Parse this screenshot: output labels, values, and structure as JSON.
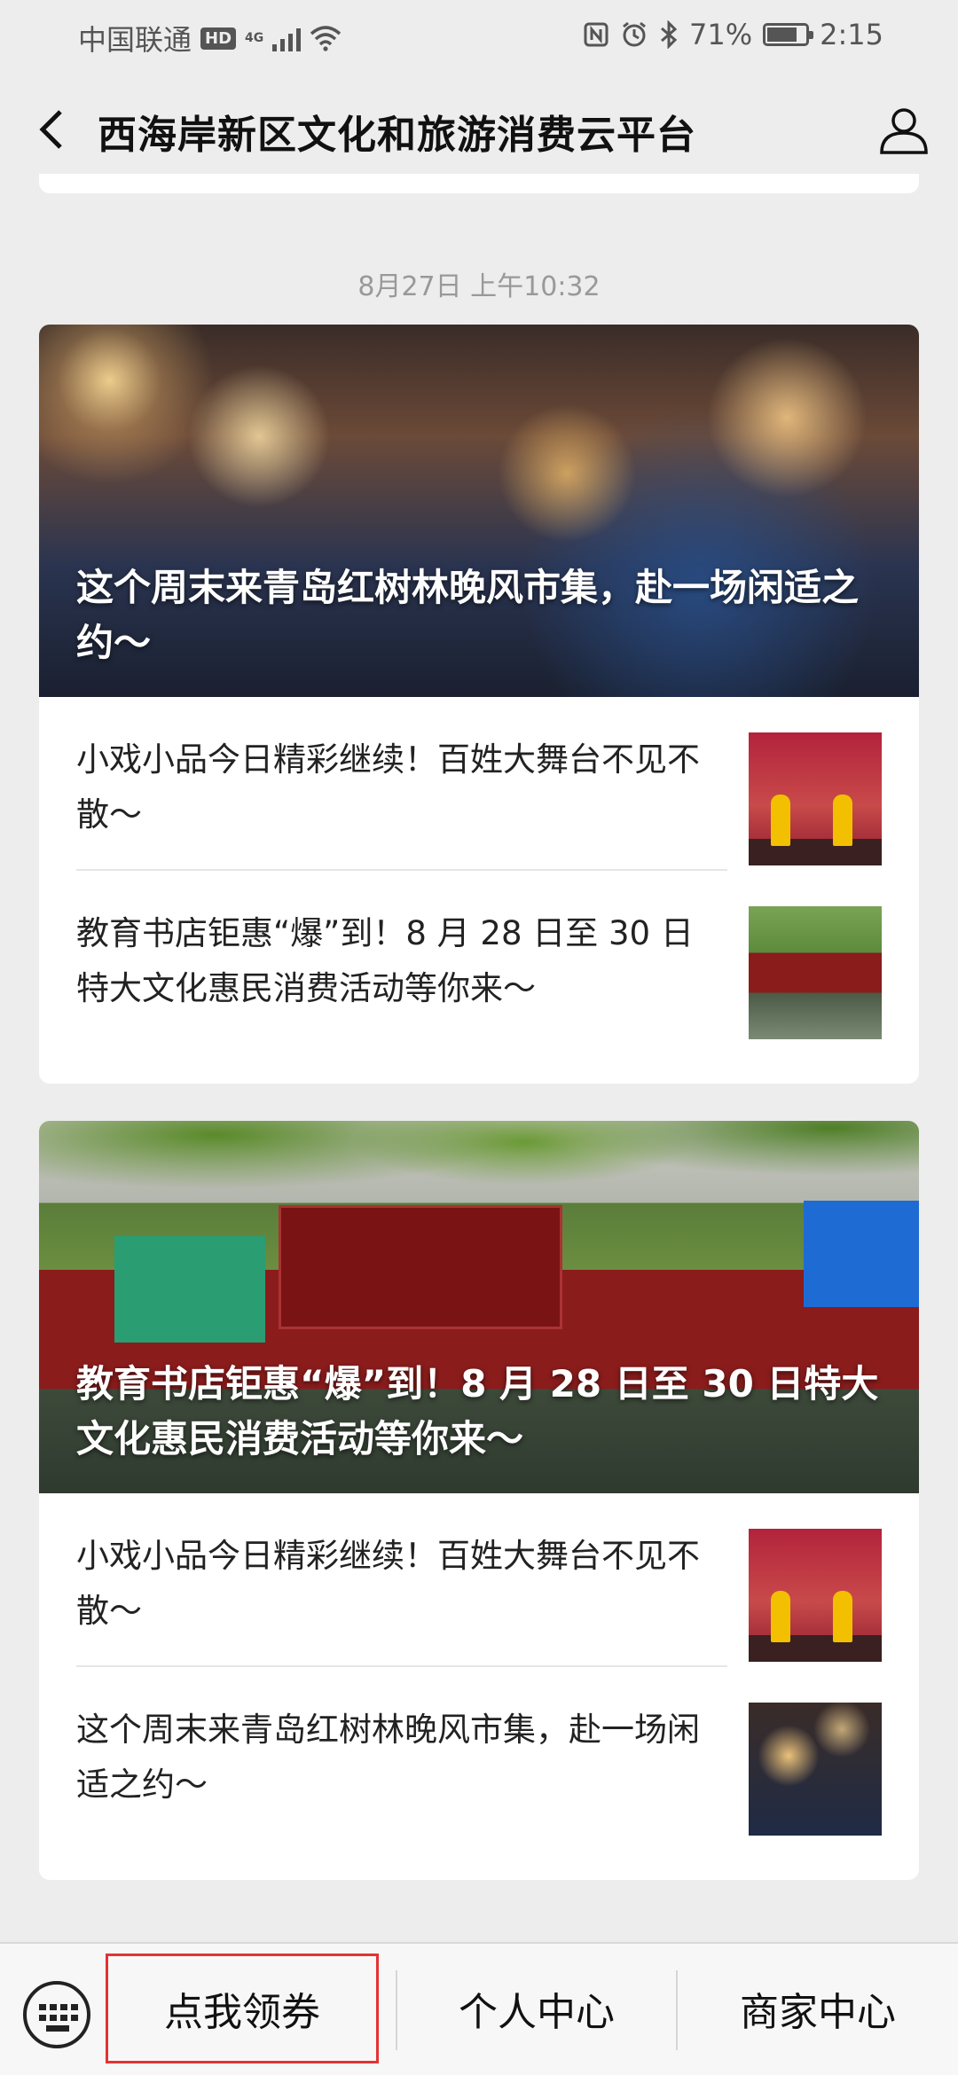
{
  "status_bar": {
    "carrier": "中国联通",
    "hd": "HD",
    "network": "4G",
    "battery_percent": "71%",
    "battery_level": 0.71,
    "time": "2:15",
    "icons": [
      "nfc-icon",
      "alarm-icon",
      "bluetooth-icon",
      "wifi-icon",
      "signal-icon",
      "battery-icon"
    ]
  },
  "header": {
    "title": "西海岸新区文化和旅游消费云平台",
    "back_icon": "back-arrow-icon",
    "user_icon": "user-profile-icon"
  },
  "feed": {
    "timestamp": "8月27日 上午10:32",
    "cards": [
      {
        "hero_title": "这个周末来青岛红树林晚风市集，赴一场闲适之约～",
        "items": [
          {
            "text": "小戏小品今日精彩继续！百姓大舞台不见不散～"
          },
          {
            "text": "教育书店钜惠“爆”到！8 月 28 日至 30 日特大文化惠民消费活动等你来～"
          }
        ]
      },
      {
        "hero_title": "教育书店钜惠“爆”到！8 月 28 日至 30 日特大文化惠民消费活动等你来～",
        "items": [
          {
            "text": "小戏小品今日精彩继续！百姓大舞台不见不散～"
          },
          {
            "text": "这个周末来青岛红树林晚风市集，赴一场闲适之约～"
          }
        ]
      }
    ]
  },
  "bottom_menu": {
    "items": [
      {
        "label": "点我领券"
      },
      {
        "label": "个人中心"
      },
      {
        "label": "商家中心"
      }
    ],
    "highlight_color": "#e33333"
  }
}
